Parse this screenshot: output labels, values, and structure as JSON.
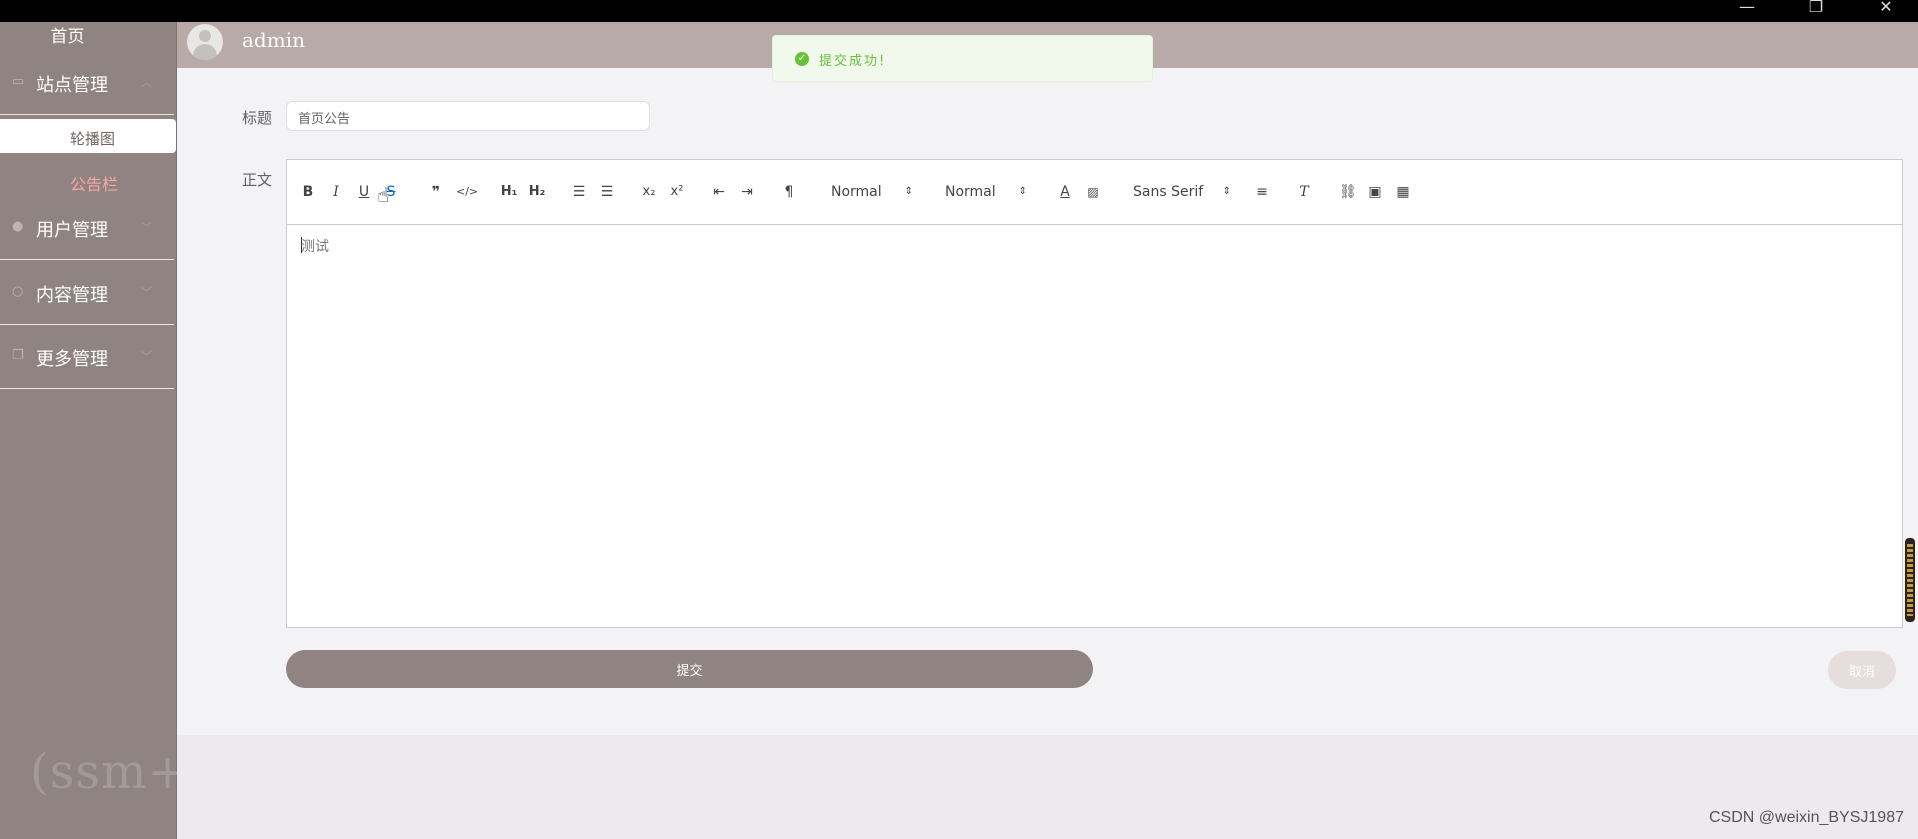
{
  "window": {
    "minimize": "—",
    "restore": "❐",
    "close": "✕"
  },
  "sidebar": {
    "home": "首页",
    "groups": [
      {
        "label": "站点管理",
        "icon": "monitor-icon"
      },
      {
        "label": "用户管理",
        "icon": "user-icon"
      },
      {
        "label": "内容管理",
        "icon": "chat-icon"
      },
      {
        "label": "更多管理",
        "icon": "copy-icon"
      }
    ],
    "sub_items": [
      "轮播图",
      "公告栏"
    ]
  },
  "header": {
    "username": "admin"
  },
  "toast": {
    "message": "提交成功!"
  },
  "form": {
    "title_label": "标题",
    "title_value": "首页公告",
    "body_label": "正文",
    "body_value": "测试",
    "submit_label": "提交",
    "cancel_label": "取消"
  },
  "editor_toolbar": {
    "header_select": "Normal",
    "size_select": "Normal",
    "font_select": "Sans Serif"
  },
  "watermark": "CSDN @weixin_BYSJ1987",
  "background_text": "(ssm+"
}
